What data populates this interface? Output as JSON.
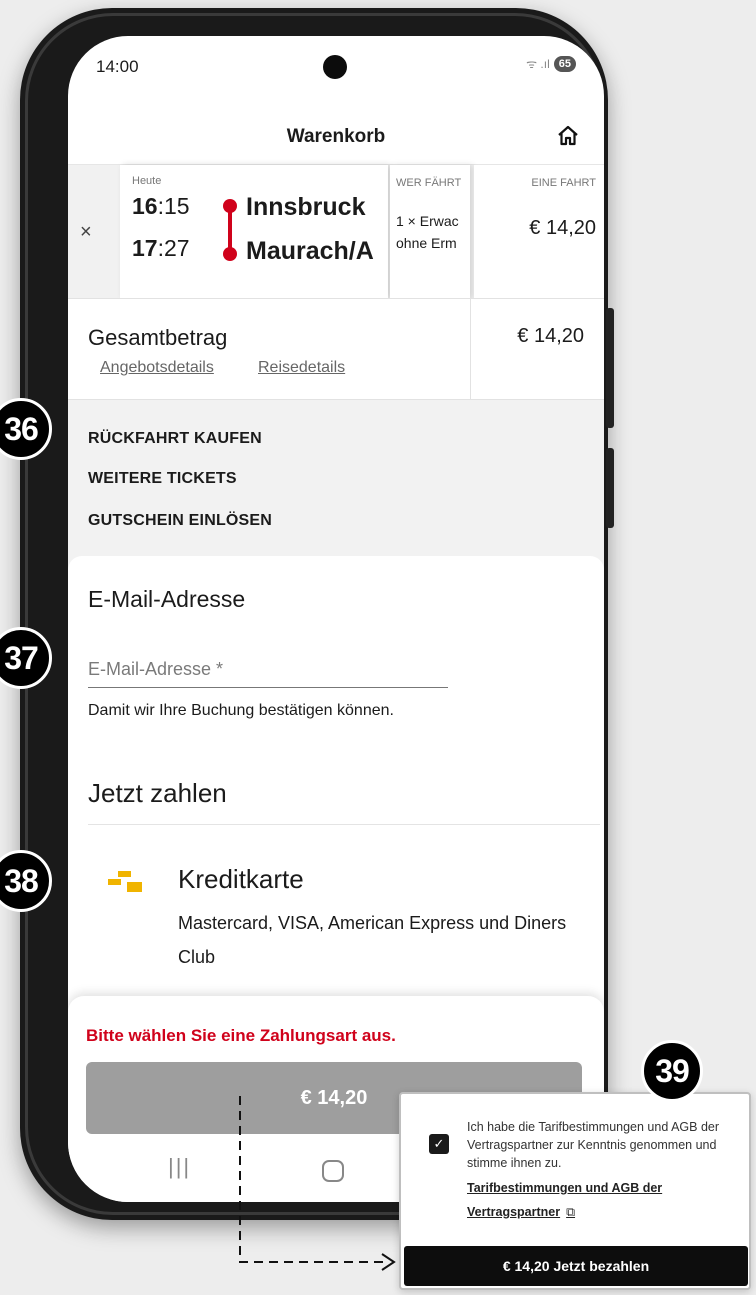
{
  "status_bar": {
    "time": "14:00",
    "signal": "ᯤ .ıl",
    "battery": "65"
  },
  "header": {
    "title": "Warenkorb",
    "home_icon": "home-icon"
  },
  "trip": {
    "remove_label": "×",
    "date_label": "Heute",
    "departure_hour": "16",
    "departure_minute": ":15",
    "arrival_hour": "17",
    "arrival_minute": ":27",
    "from": "Innsbruck",
    "to": "Maurach/A",
    "who_header": "WER FÄHRT",
    "who_line1": "1 × Erwac",
    "who_line2": "ohne Erm",
    "price_header": "EINE FAHRT",
    "price": "€ 14,20",
    "route_color": "#d0021b"
  },
  "total": {
    "label": "Gesamtbetrag",
    "offer_details": "Angebotsdetails",
    "trip_details": "Reisedetails",
    "amount": "€ 14,20"
  },
  "extras": [
    "RÜCKFAHRT KAUFEN",
    "WEITERE TICKETS",
    "GUTSCHEIN EINLÖSEN"
  ],
  "email": {
    "title": "E-Mail-Adresse",
    "placeholder": "E-Mail-Adresse *",
    "hint": "Damit wir Ihre Buchung bestätigen können."
  },
  "payment": {
    "title": "Jetzt zahlen",
    "method_name": "Kreditkarte",
    "method_desc": "Mastercard, VISA, American Express und Diners Club",
    "method_icon": "credit-card-icon",
    "icon_color": "#f0b400"
  },
  "bottom": {
    "error": "Bitte wählen Sie eine Zahlungsart aus.",
    "pay_button": "€ 14,20",
    "error_color": "#d0021b"
  },
  "android_nav": {
    "recent": "|||"
  },
  "badges": [
    "36",
    "37",
    "38",
    "39"
  ],
  "consent": {
    "checked": true,
    "text": "Ich habe die Tarifbestimmungen und AGB der Vertragspartner zur Kenntnis genommen und stimme ihnen zu.",
    "link": "Tarifbestimmungen und AGB der Vertragspartner",
    "link_icon": "external-link-icon",
    "button": "€ 14,20 Jetzt bezahlen"
  }
}
